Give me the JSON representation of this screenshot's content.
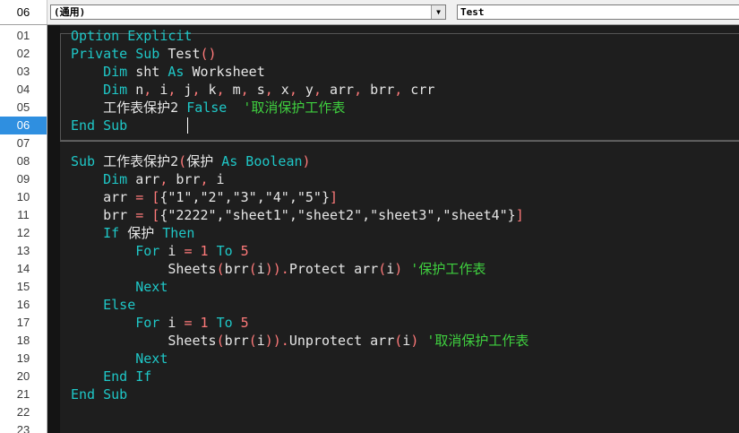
{
  "toolbar": {
    "line_number": "06",
    "object_value": "(通用)",
    "procedure_value": "Test",
    "dropdown_arrow": "▼"
  },
  "lines": [
    {
      "n": "01",
      "tokens": [
        {
          "t": "Option Explicit",
          "c": "kw"
        }
      ]
    },
    {
      "n": "02",
      "tokens": [
        {
          "t": "Private Sub",
          "c": "kw"
        },
        {
          "t": " Test",
          "c": "tx"
        },
        {
          "t": "()",
          "c": "op"
        }
      ]
    },
    {
      "n": "03",
      "tokens": [
        {
          "t": "    ",
          "c": "tx"
        },
        {
          "t": "Dim",
          "c": "kw"
        },
        {
          "t": " sht ",
          "c": "tx"
        },
        {
          "t": "As",
          "c": "kw"
        },
        {
          "t": " Worksheet",
          "c": "tx"
        }
      ]
    },
    {
      "n": "04",
      "tokens": [
        {
          "t": "    ",
          "c": "tx"
        },
        {
          "t": "Dim",
          "c": "kw"
        },
        {
          "t": " n",
          "c": "tx"
        },
        {
          "t": ",",
          "c": "op"
        },
        {
          "t": " i",
          "c": "tx"
        },
        {
          "t": ",",
          "c": "op"
        },
        {
          "t": " j",
          "c": "tx"
        },
        {
          "t": ",",
          "c": "op"
        },
        {
          "t": " k",
          "c": "tx"
        },
        {
          "t": ",",
          "c": "op"
        },
        {
          "t": " m",
          "c": "tx"
        },
        {
          "t": ",",
          "c": "op"
        },
        {
          "t": " s",
          "c": "tx"
        },
        {
          "t": ",",
          "c": "op"
        },
        {
          "t": " x",
          "c": "tx"
        },
        {
          "t": ",",
          "c": "op"
        },
        {
          "t": " y",
          "c": "tx"
        },
        {
          "t": ",",
          "c": "op"
        },
        {
          "t": " arr",
          "c": "tx"
        },
        {
          "t": ",",
          "c": "op"
        },
        {
          "t": " brr",
          "c": "tx"
        },
        {
          "t": ",",
          "c": "op"
        },
        {
          "t": " crr",
          "c": "tx"
        }
      ]
    },
    {
      "n": "05",
      "tokens": [
        {
          "t": "    工作表保护2 ",
          "c": "tx"
        },
        {
          "t": "False",
          "c": "kw"
        },
        {
          "t": "  '取消保护工作表",
          "c": "cm"
        }
      ]
    },
    {
      "n": "06",
      "tokens": [
        {
          "t": "End Sub",
          "c": "kw"
        }
      ],
      "active": true
    },
    {
      "n": "07",
      "tokens": []
    },
    {
      "n": "08",
      "tokens": [
        {
          "t": "Sub",
          "c": "kw"
        },
        {
          "t": " 工作表保护2",
          "c": "tx"
        },
        {
          "t": "(",
          "c": "op"
        },
        {
          "t": "保护 ",
          "c": "tx"
        },
        {
          "t": "As Boolean",
          "c": "kw"
        },
        {
          "t": ")",
          "c": "op"
        }
      ]
    },
    {
      "n": "09",
      "tokens": [
        {
          "t": "    ",
          "c": "tx"
        },
        {
          "t": "Dim",
          "c": "kw"
        },
        {
          "t": " arr",
          "c": "tx"
        },
        {
          "t": ",",
          "c": "op"
        },
        {
          "t": " brr",
          "c": "tx"
        },
        {
          "t": ",",
          "c": "op"
        },
        {
          "t": " i",
          "c": "tx"
        }
      ]
    },
    {
      "n": "10",
      "tokens": [
        {
          "t": "    arr ",
          "c": "tx"
        },
        {
          "t": "=",
          "c": "op"
        },
        {
          "t": " ",
          "c": "tx"
        },
        {
          "t": "[",
          "c": "op"
        },
        {
          "t": "{\"1\",\"2\",\"3\",\"4\",\"5\"}",
          "c": "tx"
        },
        {
          "t": "]",
          "c": "op"
        }
      ]
    },
    {
      "n": "11",
      "tokens": [
        {
          "t": "    brr ",
          "c": "tx"
        },
        {
          "t": "=",
          "c": "op"
        },
        {
          "t": " ",
          "c": "tx"
        },
        {
          "t": "[",
          "c": "op"
        },
        {
          "t": "{\"2222\",\"sheet1\",\"sheet2\",\"sheet3\",\"sheet4\"}",
          "c": "tx"
        },
        {
          "t": "]",
          "c": "op"
        }
      ]
    },
    {
      "n": "12",
      "tokens": [
        {
          "t": "    ",
          "c": "tx"
        },
        {
          "t": "If",
          "c": "kw"
        },
        {
          "t": " 保护 ",
          "c": "tx"
        },
        {
          "t": "Then",
          "c": "kw"
        }
      ]
    },
    {
      "n": "13",
      "tokens": [
        {
          "t": "        ",
          "c": "tx"
        },
        {
          "t": "For",
          "c": "kw"
        },
        {
          "t": " i ",
          "c": "tx"
        },
        {
          "t": "=",
          "c": "op"
        },
        {
          "t": " ",
          "c": "tx"
        },
        {
          "t": "1",
          "c": "num"
        },
        {
          "t": " ",
          "c": "tx"
        },
        {
          "t": "To",
          "c": "kw"
        },
        {
          "t": " ",
          "c": "tx"
        },
        {
          "t": "5",
          "c": "num"
        }
      ]
    },
    {
      "n": "14",
      "tokens": [
        {
          "t": "            Sheets",
          "c": "tx"
        },
        {
          "t": "(",
          "c": "op"
        },
        {
          "t": "brr",
          "c": "tx"
        },
        {
          "t": "(",
          "c": "op"
        },
        {
          "t": "i",
          "c": "tx"
        },
        {
          "t": ")).",
          "c": "op"
        },
        {
          "t": "Protect arr",
          "c": "tx"
        },
        {
          "t": "(",
          "c": "op"
        },
        {
          "t": "i",
          "c": "tx"
        },
        {
          "t": ")",
          "c": "op"
        },
        {
          "t": " '保护工作表",
          "c": "cm"
        }
      ]
    },
    {
      "n": "15",
      "tokens": [
        {
          "t": "        ",
          "c": "tx"
        },
        {
          "t": "Next",
          "c": "kw"
        }
      ]
    },
    {
      "n": "16",
      "tokens": [
        {
          "t": "    ",
          "c": "tx"
        },
        {
          "t": "Else",
          "c": "kw"
        }
      ]
    },
    {
      "n": "17",
      "tokens": [
        {
          "t": "        ",
          "c": "tx"
        },
        {
          "t": "For",
          "c": "kw"
        },
        {
          "t": " i ",
          "c": "tx"
        },
        {
          "t": "=",
          "c": "op"
        },
        {
          "t": " ",
          "c": "tx"
        },
        {
          "t": "1",
          "c": "num"
        },
        {
          "t": " ",
          "c": "tx"
        },
        {
          "t": "To",
          "c": "kw"
        },
        {
          "t": " ",
          "c": "tx"
        },
        {
          "t": "5",
          "c": "num"
        }
      ]
    },
    {
      "n": "18",
      "tokens": [
        {
          "t": "            Sheets",
          "c": "tx"
        },
        {
          "t": "(",
          "c": "op"
        },
        {
          "t": "brr",
          "c": "tx"
        },
        {
          "t": "(",
          "c": "op"
        },
        {
          "t": "i",
          "c": "tx"
        },
        {
          "t": ")).",
          "c": "op"
        },
        {
          "t": "Unprotect arr",
          "c": "tx"
        },
        {
          "t": "(",
          "c": "op"
        },
        {
          "t": "i",
          "c": "tx"
        },
        {
          "t": ")",
          "c": "op"
        },
        {
          "t": " '取消保护工作表",
          "c": "cm"
        }
      ]
    },
    {
      "n": "19",
      "tokens": [
        {
          "t": "        ",
          "c": "tx"
        },
        {
          "t": "Next",
          "c": "kw"
        }
      ]
    },
    {
      "n": "20",
      "tokens": [
        {
          "t": "    ",
          "c": "tx"
        },
        {
          "t": "End If",
          "c": "kw"
        }
      ]
    },
    {
      "n": "21",
      "tokens": [
        {
          "t": "End Sub",
          "c": "kw"
        }
      ]
    },
    {
      "n": "22",
      "tokens": []
    },
    {
      "n": "23",
      "tokens": []
    }
  ],
  "colors": {
    "keyword": "#1fc7c7",
    "number_operator": "#ff7a7a",
    "comment": "#3fcf3f",
    "text": "#e6e6e6",
    "active_line": "#2f8fe0"
  }
}
